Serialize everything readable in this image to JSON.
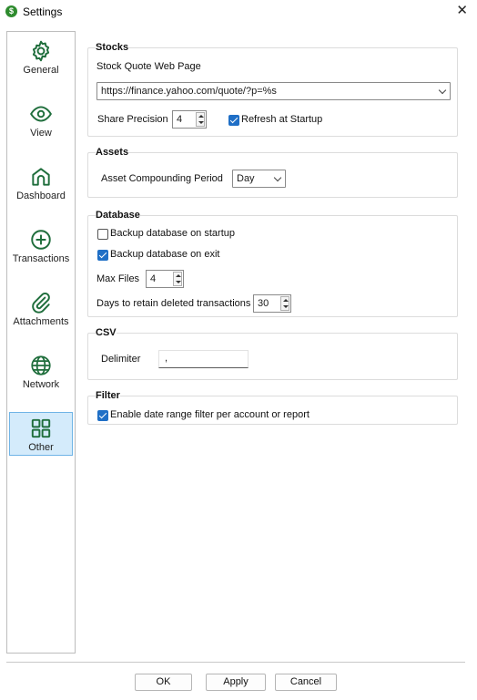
{
  "window": {
    "title": "Settings",
    "app_icon_glyph": "$",
    "close_glyph": "✕"
  },
  "sidebar": {
    "items": [
      {
        "label": "General",
        "icon": "gear-icon"
      },
      {
        "label": "View",
        "icon": "eye-icon"
      },
      {
        "label": "Dashboard",
        "icon": "home-icon"
      },
      {
        "label": "Transactions",
        "icon": "plus-circle-icon"
      },
      {
        "label": "Attachments",
        "icon": "paperclip-icon"
      },
      {
        "label": "Network",
        "icon": "globe-icon"
      },
      {
        "label": "Other",
        "icon": "grid-icon"
      }
    ],
    "selected": "Other",
    "accent_color": "#1f6e3c"
  },
  "stocks": {
    "title": "Stocks",
    "quote_label": "Stock Quote Web Page",
    "quote_url": "https://finance.yahoo.com/quote/?p=%s",
    "precision_label": "Share Precision",
    "precision_value": "4",
    "refresh_label": "Refresh at Startup",
    "refresh_checked": true
  },
  "assets": {
    "title": "Assets",
    "period_label": "Asset Compounding Period",
    "period_value": "Day"
  },
  "database": {
    "title": "Database",
    "backup_startup_label": "Backup database on startup",
    "backup_startup_checked": false,
    "backup_exit_label": "Backup database on exit",
    "backup_exit_checked": true,
    "max_files_label": "Max Files",
    "max_files_value": "4",
    "retain_label": "Days to retain deleted transactions",
    "retain_value": "30"
  },
  "csv": {
    "title": "CSV",
    "delimiter_label": "Delimiter",
    "delimiter_value": ","
  },
  "filter": {
    "title": "Filter",
    "date_range_label": "Enable date range filter per account or report",
    "date_range_checked": true
  },
  "buttons": {
    "ok": "OK",
    "apply": "Apply",
    "cancel": "Cancel"
  },
  "colors": {
    "check_blue": "#1f6fc6",
    "selected_bg": "#d4ebfb",
    "selected_border": "#6fb4e6"
  }
}
